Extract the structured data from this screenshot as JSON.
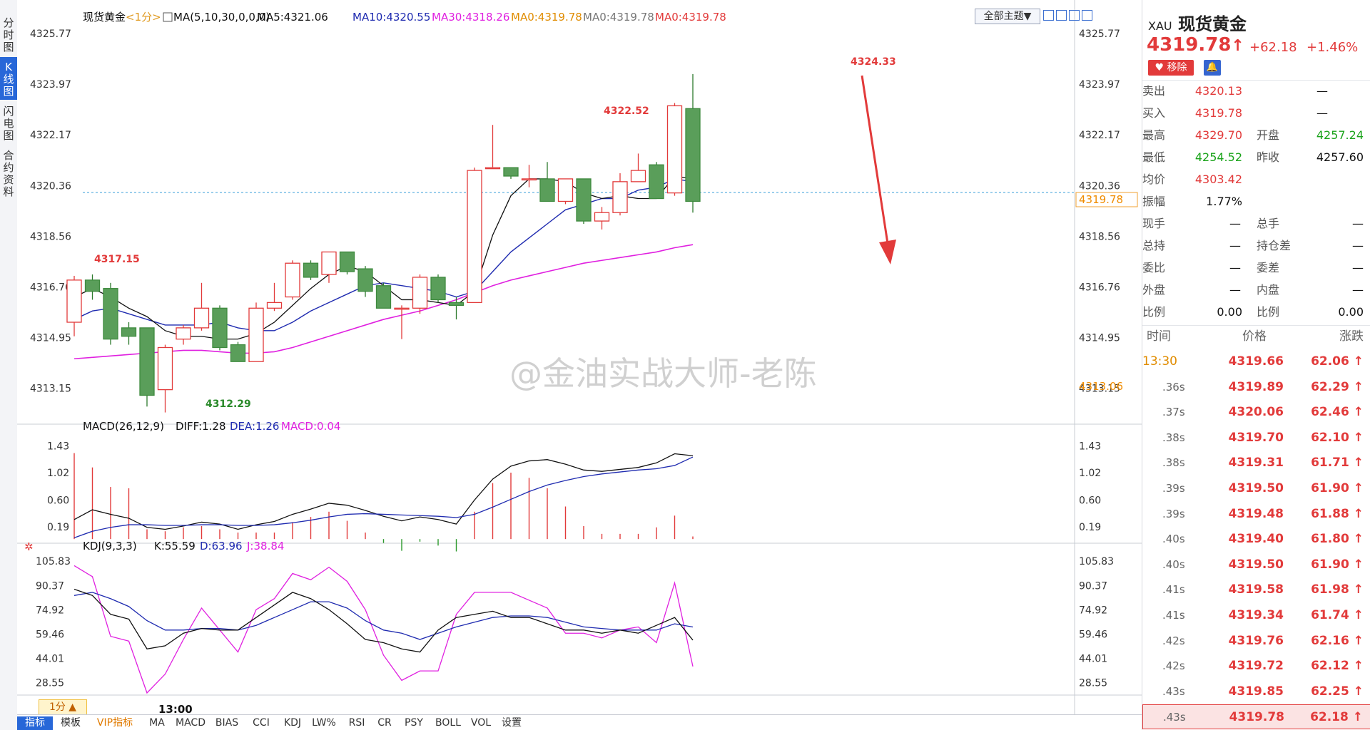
{
  "left_tabs": [
    "分时图",
    "K线图",
    "闪电图",
    "合约资料"
  ],
  "chart": {
    "name": "现货黄金",
    "period": "<1分>",
    "ma_spec": "MA(5,10,30,0,0,0)",
    "ma5": "MA5:4321.06",
    "ma10": "MA10:4320.55",
    "ma30": "MA30:4318.26",
    "ma0a": "MA0:4319.78",
    "ma0b": "MA0:4319.78",
    "ma0c": "MA0:4319.78",
    "theme_btn": "全部主题▼",
    "y_ticks": [
      "4325.77",
      "4323.97",
      "4322.17",
      "4320.36",
      "4318.56",
      "4316.76",
      "4314.95",
      "4313.15"
    ],
    "last_price_tag": "4319.78",
    "low_price_tag": "4313.06",
    "annotations": [
      "4317.15",
      "4312.29",
      "4322.52",
      "4324.33"
    ],
    "time_label": "13:00",
    "timeframe": "1分 ▲"
  },
  "macd": {
    "title": "MACD(26,12,9)",
    "diff": "DIFF:1.28",
    "dea": "DEA:1.26",
    "macd": "MACD:0.04",
    "ticks": [
      "1.43",
      "1.02",
      "0.60",
      "0.19"
    ]
  },
  "kdj": {
    "title": "KDJ(9,3,3)",
    "k": "K:55.59",
    "d": "D:63.96",
    "j": "J:38.84",
    "ticks": [
      "105.83",
      "90.37",
      "74.92",
      "59.46",
      "44.01",
      "28.55"
    ]
  },
  "bottom_tabs": [
    "指标",
    "模板",
    "VIP指标",
    "MA",
    "MACD",
    "BIAS",
    "CCI",
    "KDJ",
    "LW%",
    "RSI",
    "CR",
    "PSY",
    "BOLL",
    "VOL",
    "设置"
  ],
  "watermark": "@金油实战大师-老陈",
  "colors": {
    "up": "#e23a3a",
    "down": "#5a9e5a",
    "ma5": "#111111",
    "ma10": "#1f2bb0",
    "ma30": "#e020e0",
    "accent": "#2767d8"
  },
  "quote": {
    "symbol": "XAU",
    "name": "现货黄金",
    "price": "4319.78",
    "arrow": "↑",
    "change": "+62.18",
    "pct": "+1.46%",
    "remove_btn": "移除",
    "rows": [
      {
        "l1": "卖出",
        "v1": "4320.13",
        "l2": "",
        "v2": "—"
      },
      {
        "l1": "买入",
        "v1": "4319.78",
        "l2": "",
        "v2": "—"
      },
      {
        "l1": "最高",
        "v1": "4329.70",
        "l2": "开盘",
        "v2": "4257.24"
      },
      {
        "l1": "最低",
        "v1": "4254.52",
        "l2": "昨收",
        "v2": "4257.60"
      },
      {
        "l1": "均价",
        "v1": "4303.42",
        "l2": "",
        "v2": ""
      },
      {
        "l1": "振幅",
        "v1": "1.77%",
        "l2": "",
        "v2": ""
      },
      {
        "l1": "现手",
        "v1": "—",
        "l2": "总手",
        "v2": "—"
      },
      {
        "l1": "总持",
        "v1": "—",
        "l2": "持仓差",
        "v2": "—"
      },
      {
        "l1": "委比",
        "v1": "—",
        "l2": "委差",
        "v2": "—"
      },
      {
        "l1": "外盘",
        "v1": "—",
        "l2": "内盘",
        "v2": "—"
      },
      {
        "l1": "比例",
        "v1": "0.00",
        "l2": "比例",
        "v2": "0.00"
      }
    ]
  },
  "ticks_table": {
    "headers": [
      "时间",
      "价格",
      "涨跌"
    ],
    "rows": [
      {
        "t": "13:30",
        "p": "4319.66",
        "c": "62.06"
      },
      {
        "t": ".36s",
        "p": "4319.89",
        "c": "62.29"
      },
      {
        "t": ".37s",
        "p": "4320.06",
        "c": "62.46"
      },
      {
        "t": ".38s",
        "p": "4319.70",
        "c": "62.10"
      },
      {
        "t": ".38s",
        "p": "4319.31",
        "c": "61.71"
      },
      {
        "t": ".39s",
        "p": "4319.50",
        "c": "61.90"
      },
      {
        "t": ".39s",
        "p": "4319.48",
        "c": "61.88"
      },
      {
        "t": ".40s",
        "p": "4319.40",
        "c": "61.80"
      },
      {
        "t": ".40s",
        "p": "4319.50",
        "c": "61.90"
      },
      {
        "t": ".41s",
        "p": "4319.58",
        "c": "61.98"
      },
      {
        "t": ".41s",
        "p": "4319.34",
        "c": "61.74"
      },
      {
        "t": ".42s",
        "p": "4319.76",
        "c": "62.16"
      },
      {
        "t": ".42s",
        "p": "4319.72",
        "c": "62.12"
      },
      {
        "t": ".43s",
        "p": "4319.85",
        "c": "62.25"
      },
      {
        "t": ".43s",
        "p": "4319.78",
        "c": "62.18"
      }
    ]
  },
  "chart_data": {
    "type": "candlestick",
    "y_range": [
      4312.0,
      4326.0
    ],
    "candles": [
      [
        4315.5,
        4317.0,
        4317.15,
        4315.0
      ],
      [
        4317.0,
        4316.6,
        4317.2,
        4316.3
      ],
      [
        4316.7,
        4314.9,
        4316.9,
        4314.7
      ],
      [
        4315.3,
        4315.0,
        4315.5,
        4314.7
      ],
      [
        4315.3,
        4312.9,
        4315.3,
        4312.5
      ],
      [
        4313.1,
        4314.6,
        4314.7,
        4312.29
      ],
      [
        4314.9,
        4315.3,
        4315.4,
        4314.7
      ],
      [
        4315.3,
        4316.0,
        4316.9,
        4315.2
      ],
      [
        4316.0,
        4314.6,
        4316.1,
        4314.5
      ],
      [
        4314.7,
        4314.1,
        4314.8,
        4314.1
      ],
      [
        4314.1,
        4316.0,
        4316.2,
        4314.1
      ],
      [
        4316.0,
        4316.2,
        4316.9,
        4315.9
      ],
      [
        4316.4,
        4317.6,
        4317.7,
        4316.3
      ],
      [
        4317.6,
        4317.1,
        4317.7,
        4317.0
      ],
      [
        4317.2,
        4318.0,
        4318.0,
        4316.9
      ],
      [
        4318.0,
        4317.3,
        4318.0,
        4317.2
      ],
      [
        4317.4,
        4316.6,
        4317.5,
        4316.4
      ],
      [
        4316.8,
        4316.0,
        4316.9,
        4316.0
      ],
      [
        4316.0,
        4316.0,
        4316.1,
        4314.9
      ],
      [
        4316.0,
        4317.1,
        4317.2,
        4315.8
      ],
      [
        4317.1,
        4316.3,
        4317.2,
        4316.2
      ],
      [
        4316.2,
        4316.1,
        4316.4,
        4315.6
      ],
      [
        4316.2,
        4320.9,
        4321.0,
        4316.2
      ],
      [
        4321.0,
        4321.0,
        4322.52,
        4321.0
      ],
      [
        4321.0,
        4320.7,
        4321.0,
        4320.6
      ],
      [
        4320.6,
        4320.6,
        4321.1,
        4320.3
      ],
      [
        4320.6,
        4319.8,
        4321.2,
        4319.8
      ],
      [
        4319.8,
        4320.6,
        4320.6,
        4319.7
      ],
      [
        4320.6,
        4319.1,
        4320.6,
        4319.0
      ],
      [
        4319.1,
        4319.4,
        4319.6,
        4318.8
      ],
      [
        4319.4,
        4320.5,
        4320.8,
        4319.3
      ],
      [
        4320.5,
        4320.9,
        4321.5,
        4320.8
      ],
      [
        4321.1,
        4319.9,
        4321.2,
        4319.9
      ],
      [
        4320.1,
        4323.2,
        4323.3,
        4320.0
      ],
      [
        4323.1,
        4319.8,
        4324.33,
        4319.4
      ]
    ],
    "ma5": [
      4316.4,
      4316.7,
      4316.4,
      4316.0,
      4315.7,
      4315.2,
      4315.0,
      4315.0,
      4314.9,
      4314.9,
      4315.1,
      4315.5,
      4316.1,
      4316.7,
      4317.2,
      4317.5,
      4317.3,
      4316.8,
      4316.3,
      4316.3,
      4316.2,
      4316.1,
      4316.6,
      4318.6,
      4320.0,
      4320.6,
      4320.6,
      4320.5,
      4320.1,
      4319.9,
      4320.0,
      4319.9,
      4319.9,
      4320.7,
      4320.6
    ],
    "ma10": [
      4315.6,
      4315.9,
      4316.0,
      4315.8,
      4315.6,
      4315.4,
      4315.4,
      4315.4,
      4315.5,
      4315.3,
      4315.2,
      4315.2,
      4315.5,
      4315.9,
      4316.2,
      4316.5,
      4316.8,
      4316.9,
      4316.8,
      4316.7,
      4316.6,
      4316.4,
      4316.6,
      4317.3,
      4318.0,
      4318.5,
      4319.0,
      4319.5,
      4319.7,
      4319.9,
      4319.9,
      4320.2,
      4320.3,
      4320.6,
      4320.5
    ],
    "ma30": [
      4314.2,
      4314.25,
      4314.3,
      4314.35,
      4314.4,
      4314.45,
      4314.5,
      4314.5,
      4314.45,
      4314.4,
      4314.4,
      4314.45,
      4314.6,
      4314.8,
      4315.0,
      4315.2,
      4315.4,
      4315.6,
      4315.75,
      4315.9,
      4316.1,
      4316.3,
      4316.55,
      4316.8,
      4317.0,
      4317.15,
      4317.3,
      4317.45,
      4317.6,
      4317.7,
      4317.8,
      4317.9,
      4318.0,
      4318.15,
      4318.26
    ],
    "macd_y_range": [
      -0.02,
      1.6
    ],
    "diff": [
      0.3,
      0.45,
      0.38,
      0.32,
      0.18,
      0.15,
      0.2,
      0.26,
      0.23,
      0.15,
      0.22,
      0.27,
      0.38,
      0.46,
      0.55,
      0.52,
      0.44,
      0.35,
      0.28,
      0.34,
      0.3,
      0.23,
      0.6,
      0.92,
      1.12,
      1.2,
      1.22,
      1.15,
      1.06,
      1.04,
      1.07,
      1.1,
      1.17,
      1.31,
      1.28
    ],
    "dea": [
      0.02,
      0.12,
      0.18,
      0.22,
      0.22,
      0.21,
      0.21,
      0.22,
      0.22,
      0.21,
      0.21,
      0.22,
      0.25,
      0.29,
      0.34,
      0.38,
      0.39,
      0.38,
      0.37,
      0.36,
      0.35,
      0.33,
      0.38,
      0.49,
      0.61,
      0.73,
      0.83,
      0.9,
      0.96,
      1.0,
      1.03,
      1.06,
      1.08,
      1.13,
      1.26
    ],
    "macd": [
      1.32,
      1.1,
      0.8,
      0.78,
      0.15,
      0.12,
      0.18,
      0.2,
      0.15,
      0.1,
      0.1,
      0.1,
      0.26,
      0.34,
      0.42,
      0.28,
      0.1,
      -0.06,
      -0.18,
      -0.04,
      -0.1,
      -0.19,
      0.42,
      0.86,
      1.02,
      0.94,
      0.78,
      0.5,
      0.2,
      0.08,
      0.08,
      0.08,
      0.18,
      0.36,
      0.04
    ],
    "kdj_y_range": [
      22,
      110
    ],
    "k": [
      88,
      84,
      72,
      69,
      50,
      52,
      60,
      63,
      62,
      62,
      70,
      78,
      86,
      82,
      75,
      66,
      56,
      54,
      50,
      48,
      62,
      70,
      72,
      74,
      70,
      70,
      66,
      62,
      62,
      60,
      62,
      60,
      65,
      70,
      55.59
    ],
    "d": [
      84,
      86,
      82,
      77,
      68,
      62,
      62,
      63,
      63,
      62,
      65,
      70,
      75,
      80,
      80,
      76,
      68,
      62,
      60,
      56,
      60,
      64,
      67,
      70,
      71,
      71,
      70,
      67,
      64,
      63,
      62,
      62,
      62,
      66,
      63.96
    ],
    "j": [
      103,
      96,
      58,
      55,
      22,
      34,
      56,
      76,
      62,
      48,
      75,
      82,
      98,
      94,
      102,
      93,
      75,
      46,
      30,
      36,
      36,
      72,
      86,
      86,
      86,
      81,
      76,
      60,
      60,
      57,
      62,
      64,
      54,
      92,
      38.84
    ]
  }
}
